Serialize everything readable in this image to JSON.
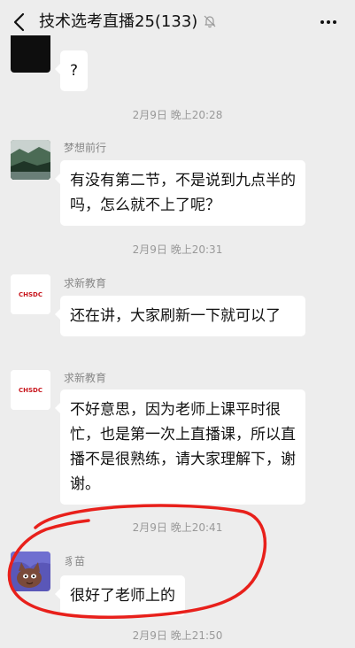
{
  "header": {
    "title": "技术选考直播25(133)"
  },
  "messages": [
    {
      "text": "?"
    },
    {
      "timestamp": "2月9日 晚上20:28",
      "sender": "梦想前行",
      "text": "有没有第二节，不是说到九点半的吗，怎么就不上了呢？"
    },
    {
      "timestamp": "2月9日 晚上20:31",
      "sender": "求新教育",
      "text": "还在讲，大家刷新一下就可以了"
    },
    {
      "sender": "求新教育",
      "text": "不好意思，因为老师上课平时很忙，也是第一次上直播课，所以直播不是很熟练，请大家理解下，谢谢。"
    },
    {
      "timestamp": "2月9日 晚上20:41",
      "sender": "豸苗",
      "text": "很好了老师上的"
    },
    {
      "timestamp": "2月9日 晚上21:50"
    }
  ],
  "avatar_logo_text": "CHSDC",
  "colors": {
    "background": "#ededed",
    "bubble": "#ffffff",
    "annotation_circle": "#e8201b"
  },
  "icons": {
    "back": "back-arrow-icon",
    "mute": "mute-bell-icon",
    "more": "more-dots-icon"
  }
}
